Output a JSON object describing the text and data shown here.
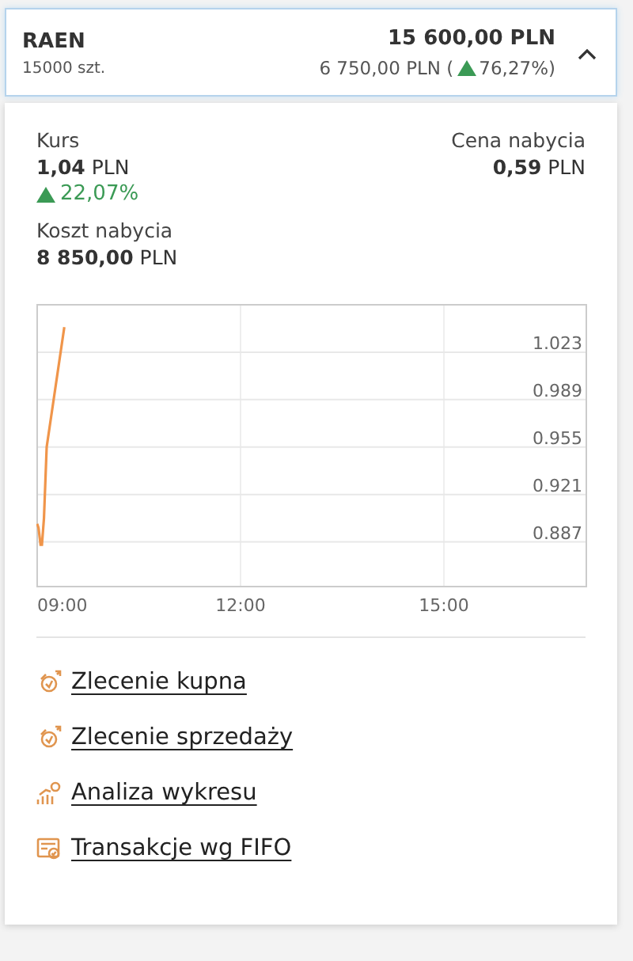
{
  "position": {
    "ticker": "RAEN",
    "quantity": "15000 szt.",
    "value": "15 600,00 PLN",
    "profit": "6 750,00 PLN (",
    "profit_change": "76,27%)",
    "rising": true,
    "expanded": true
  },
  "details": {
    "price": {
      "label": "Kurs",
      "amount": "1,04",
      "currency": "PLN",
      "change": "22,07%",
      "rising": true
    },
    "purchase_price": {
      "label": "Cena nabycia",
      "amount": "0,59",
      "currency": "PLN"
    },
    "purchase_cost": {
      "label": "Koszt nabycia",
      "amount": "8 850,00",
      "currency": "PLN"
    }
  },
  "chart_data": {
    "type": "line",
    "x": [
      9.0,
      9.02,
      9.05,
      9.07,
      9.1,
      9.14,
      9.4
    ],
    "grid": true,
    "series": [
      {
        "color": "#f0954a",
        "values": [
          0.9,
          0.897,
          0.885,
          0.885,
          0.904,
          0.955,
          1.041
        ]
      }
    ],
    "xlim": [
      9,
      17.1
    ],
    "ylim": [
      0.855,
      1.057
    ],
    "xticks": [
      {
        "value": 9,
        "label": "09:00"
      },
      {
        "value": 12,
        "label": "12:00"
      },
      {
        "value": 15,
        "label": "15:00"
      }
    ],
    "yticks": [
      0.887,
      0.921,
      0.955,
      0.989,
      1.023
    ]
  },
  "actions": [
    {
      "label": "Zlecenie kupna",
      "kind": "buy"
    },
    {
      "label": "Zlecenie sprzedaży",
      "kind": "sell"
    },
    {
      "label": "Analiza wykresu",
      "kind": "analysis"
    },
    {
      "label": "Transakcje wg FIFO",
      "kind": "fifo"
    }
  ]
}
